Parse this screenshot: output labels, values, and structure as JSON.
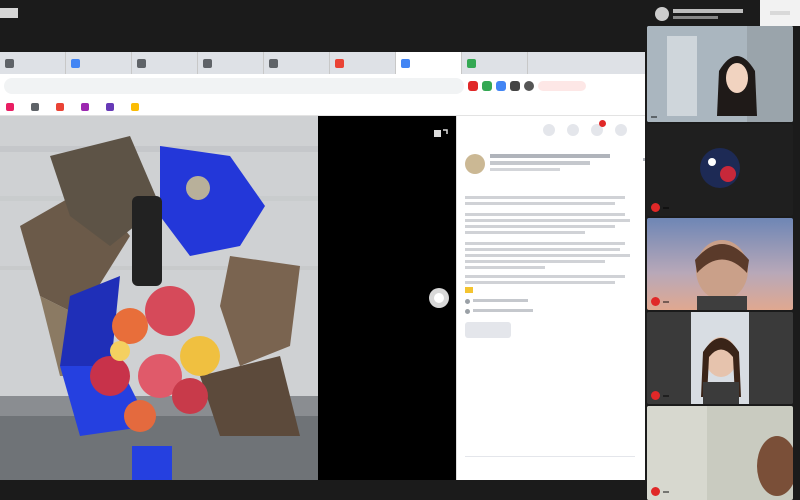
{
  "zoom": {
    "presenter_name": "",
    "presenter_sub": ""
  },
  "browser": {
    "tabs": [
      {
        "label": "",
        "color": "#5f6368"
      },
      {
        "label": "",
        "color": "#4285f4"
      },
      {
        "label": "",
        "color": "#5f6368"
      },
      {
        "label": "",
        "color": "#5f6368"
      },
      {
        "label": "",
        "color": "#5f6368"
      },
      {
        "label": "",
        "color": "#ea4335"
      },
      {
        "label": "",
        "color": "#4285f4"
      },
      {
        "label": "",
        "color": "#34a853"
      }
    ],
    "url": "",
    "bookmarks": [
      {
        "label": "",
        "color": "#e91e63"
      },
      {
        "label": "",
        "color": "#5f6368"
      },
      {
        "label": "",
        "color": "#ea4335"
      },
      {
        "label": "",
        "color": "#9c27b0"
      },
      {
        "label": "",
        "color": "#673ab7"
      },
      {
        "label": "",
        "color": "#fbbc04"
      }
    ]
  },
  "post": {
    "author": "",
    "time": "",
    "paragraphs": [
      "",
      "",
      "",
      ""
    ],
    "list_items": [
      "",
      ""
    ],
    "button_label": "",
    "comment_placeholder": ""
  },
  "participants": [
    {
      "name": "",
      "muted": false
    },
    {
      "name": "",
      "muted": true
    },
    {
      "name": "",
      "muted": true
    },
    {
      "name": "",
      "muted": true
    },
    {
      "name": "",
      "muted": true
    }
  ],
  "colors": {
    "brand_red": "#e02828",
    "post_accent": "#3b5998",
    "bouquet_blue": "#2337d9"
  }
}
